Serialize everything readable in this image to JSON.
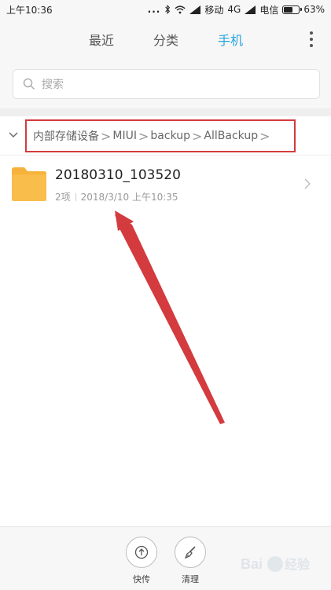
{
  "status_bar": {
    "time": "上午10:36",
    "dots": "...",
    "carrier_1": "移动",
    "network": "4G",
    "carrier_2": "电信",
    "battery": "63%",
    "battery_level": 0.63
  },
  "tabs": [
    {
      "label": "最近",
      "active": false
    },
    {
      "label": "分类",
      "active": false
    },
    {
      "label": "手机",
      "active": true
    }
  ],
  "search": {
    "placeholder": "搜索"
  },
  "breadcrumb": {
    "items": [
      "内部存储设备",
      "MIUI",
      "backup",
      "AllBackup"
    ],
    "separator": ">"
  },
  "files": [
    {
      "name": "20180310_103520",
      "count": "2项",
      "date": "2018/3/10 上午10:35",
      "icon": "folder-icon"
    }
  ],
  "actions": [
    {
      "label": "快传",
      "icon": "share-icon"
    },
    {
      "label": "清理",
      "icon": "brush-icon"
    }
  ],
  "watermark": {
    "text": "Bai 经验"
  },
  "colors": {
    "accent": "#2aa5e0",
    "folder": "#f6b23a",
    "annotation": "#d33b3f"
  }
}
